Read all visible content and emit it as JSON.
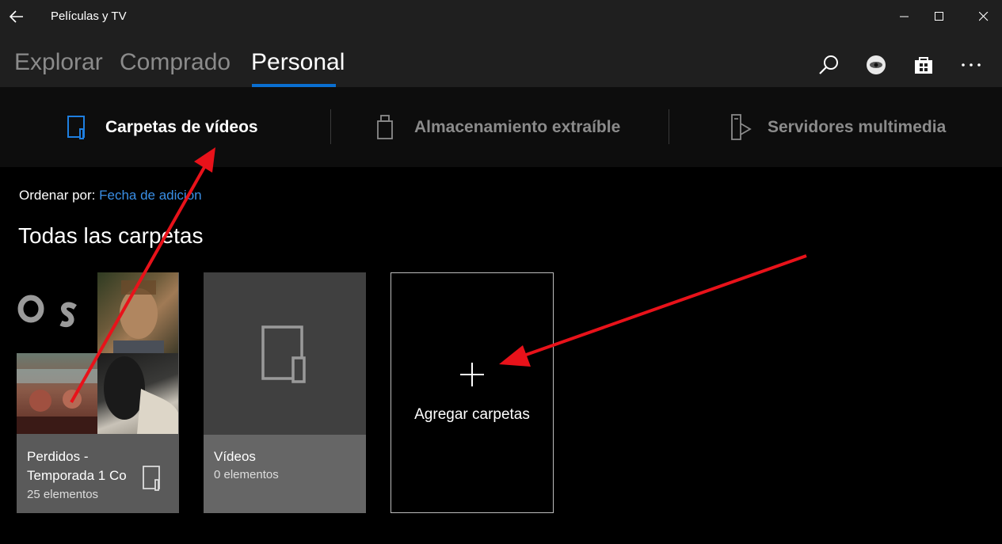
{
  "window": {
    "title": "Películas y TV",
    "back_icon": "back-arrow-icon",
    "controls": [
      "minimize-icon",
      "maximize-icon",
      "close-icon"
    ]
  },
  "nav": {
    "tabs": [
      {
        "label": "Explorar",
        "active": false
      },
      {
        "label": "Comprado",
        "active": false
      },
      {
        "label": "Personal",
        "active": true
      }
    ],
    "accent_color": "#0a6fd1",
    "actions": [
      "search-icon",
      "avatar",
      "store-icon",
      "more-options-icon"
    ]
  },
  "subnav": {
    "items": [
      {
        "label": "Carpetas de vídeos",
        "icon": "folder-icon",
        "active": true
      },
      {
        "label": "Almacenamiento extraíble",
        "icon": "usb-drive-icon",
        "active": false
      },
      {
        "label": "Servidores multimedia",
        "icon": "media-server-icon",
        "active": false
      }
    ]
  },
  "sort": {
    "label": "Ordenar por:",
    "value": "Fecha de adición"
  },
  "section_title": "Todas las carpetas",
  "folders": [
    {
      "name_line1": "Perdidos -",
      "name_line2": "Temporada 1 Co",
      "count": "25 elementos"
    },
    {
      "name_line1": "Vídeos",
      "count": "0 elementos"
    }
  ],
  "add_folder": {
    "label": "Agregar carpetas"
  },
  "annotation": {
    "arrow_color": "#e8121a"
  }
}
